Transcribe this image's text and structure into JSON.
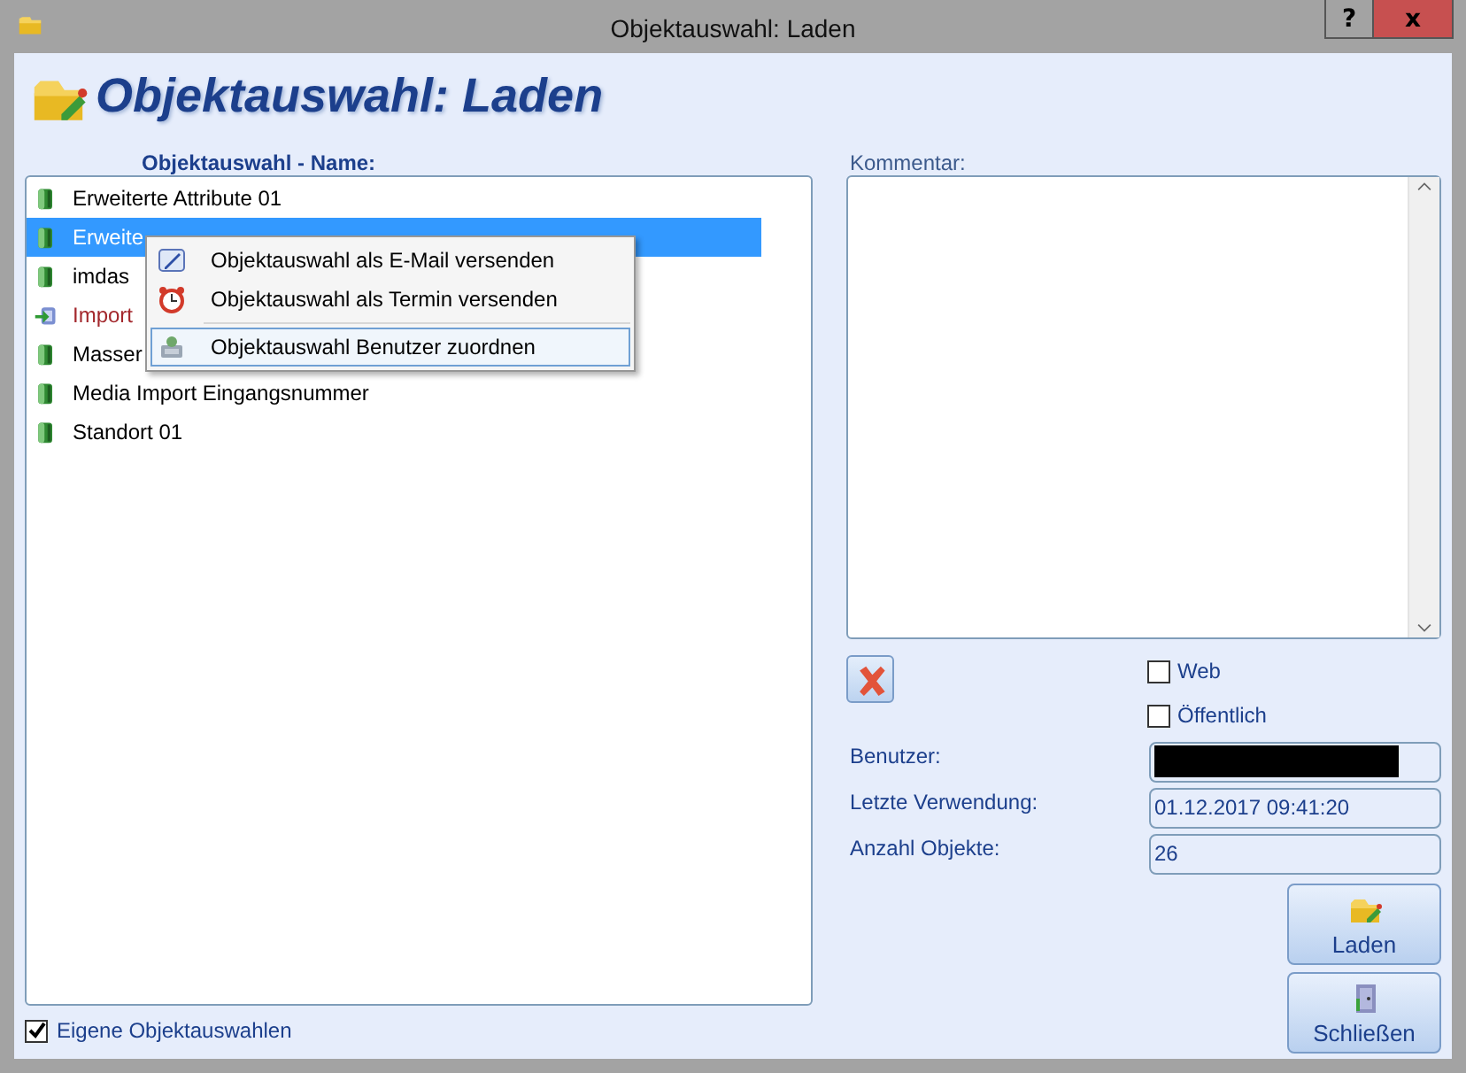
{
  "window": {
    "title": "Objektauswahl: Laden",
    "help_button": "?",
    "close_button": "x"
  },
  "header": {
    "title": "Objektauswahl: Laden"
  },
  "list": {
    "label": "Objektauswahl - Name:",
    "items": [
      {
        "label": "Erweiterte Attribute 01",
        "kind": "book",
        "selected": false
      },
      {
        "label": "Erweite",
        "kind": "book",
        "selected": true
      },
      {
        "label": "imdas",
        "kind": "book",
        "selected": false
      },
      {
        "label": "Import",
        "kind": "import",
        "selected": false
      },
      {
        "label": "Masser",
        "kind": "book",
        "selected": false
      },
      {
        "label": "Media Import Eingangsnummer",
        "kind": "book",
        "selected": false
      },
      {
        "label": "Standort 01",
        "kind": "book",
        "selected": false
      }
    ]
  },
  "context_menu": {
    "items": [
      {
        "label": "Objektauswahl als E-Mail versenden",
        "kind": "mail",
        "selected": false
      },
      {
        "label": "Objektauswahl als Termin versenden",
        "kind": "clock",
        "selected": false
      },
      {
        "label": "Objektauswahl Benutzer zuordnen",
        "kind": "user",
        "selected": true,
        "separator_before": true
      }
    ]
  },
  "own_selections": {
    "label": "Eigene Objektauswahlen",
    "checked": true
  },
  "comment": {
    "label": "Kommentar:"
  },
  "checkboxes": [
    {
      "label": "Web",
      "checked": false
    },
    {
      "label": "Öffentlich",
      "checked": false
    }
  ],
  "fields": [
    {
      "label": "Benutzer:",
      "redacted": true
    },
    {
      "label": "Letzte Verwendung:",
      "value": "01.12.2017 09:41:20"
    },
    {
      "label": "Anzahl Objekte:",
      "value": "26"
    }
  ],
  "buttons": [
    {
      "label": "Laden",
      "kind": "folder"
    },
    {
      "label": "Schließen",
      "kind": "door"
    }
  ]
}
